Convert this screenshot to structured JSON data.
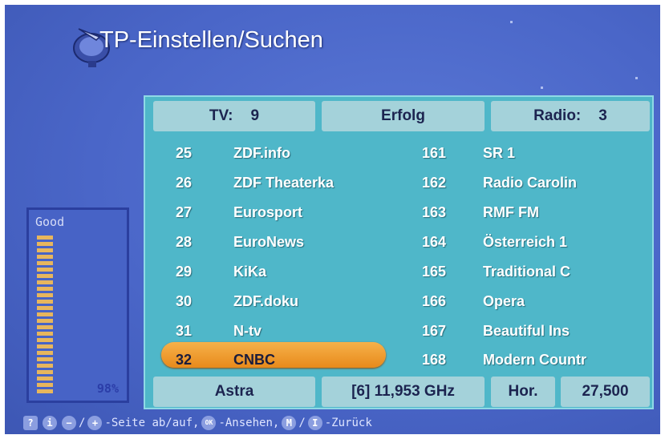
{
  "screen": {
    "title": "TP-Einstellen/Suchen",
    "accent_colors": {
      "panel": "#4fb7c9",
      "header_cell": "#a4d2da",
      "selection": "#f0a03a",
      "background": "#4a66c8"
    }
  },
  "status": {
    "tv_label": "TV:",
    "tv_count": "9",
    "result": "Erfolg",
    "radio_label": "Radio:",
    "radio_count": "3"
  },
  "tv_channels": [
    {
      "num": "25",
      "name": "ZDF.info"
    },
    {
      "num": "26",
      "name": "ZDF Theaterka"
    },
    {
      "num": "27",
      "name": "Eurosport"
    },
    {
      "num": "28",
      "name": "EuroNews"
    },
    {
      "num": "29",
      "name": "KiKa"
    },
    {
      "num": "30",
      "name": "ZDF.doku"
    },
    {
      "num": "31",
      "name": "N-tv"
    },
    {
      "num": "32",
      "name": "CNBC",
      "selected": true
    }
  ],
  "radio_channels": [
    {
      "num": "161",
      "name": "SR 1"
    },
    {
      "num": "162",
      "name": "Radio Carolin"
    },
    {
      "num": "163",
      "name": "RMF FM"
    },
    {
      "num": "164",
      "name": "Österreich 1"
    },
    {
      "num": "165",
      "name": "Traditional C"
    },
    {
      "num": "166",
      "name": "Opera"
    },
    {
      "num": "167",
      "name": "Beautiful Ins"
    },
    {
      "num": "168",
      "name": "Modern Countr"
    }
  ],
  "transponder": {
    "satellite": "Astra",
    "frequency": "[6] 11,953 GHz",
    "polarization": "Hor.",
    "symbol_rate": "27,500"
  },
  "signal": {
    "label": "Good",
    "percent_text": "98%",
    "level": 0.98
  },
  "footer_hint": {
    "help_icon": "?",
    "info_icon": "i",
    "minus_icon": "−",
    "slash1": "/",
    "plus_icon": "+",
    "page_text": "-Seite ab/auf,",
    "ok_icon": "OK",
    "view_text": "-Ansehen,",
    "menu_icon": "M",
    "slash2": "/",
    "exit_icon": "I",
    "back_text": "-Zurück"
  }
}
